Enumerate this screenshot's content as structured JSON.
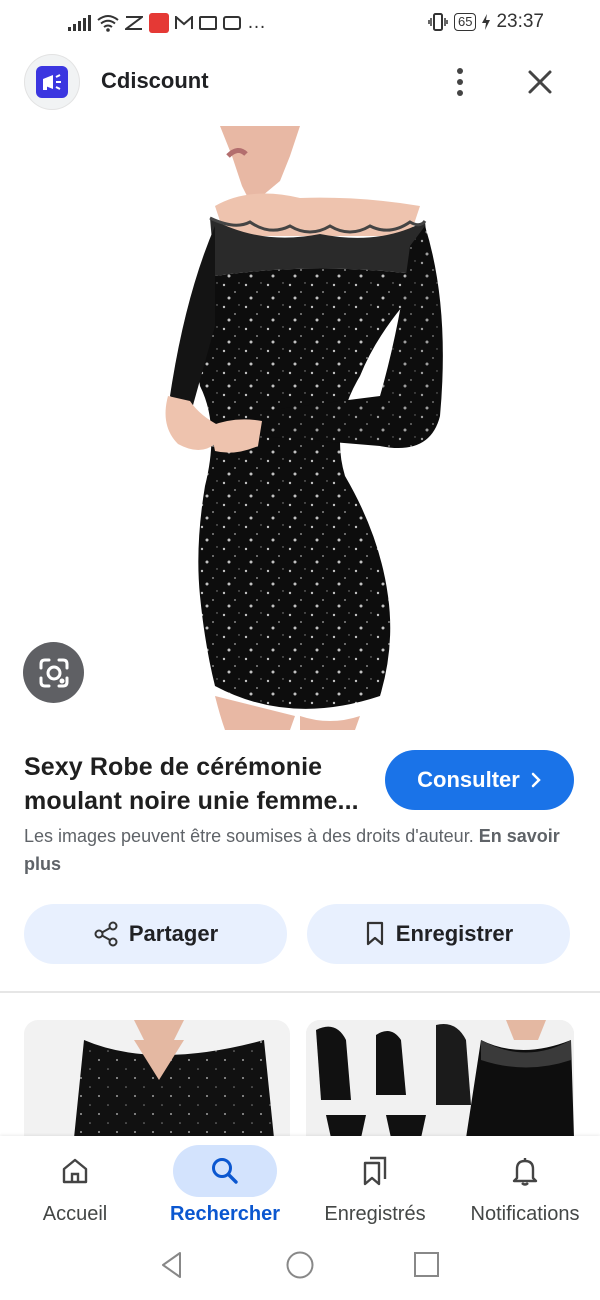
{
  "status_bar": {
    "time": "23:37",
    "battery": "65",
    "overflow": "…"
  },
  "app_bar": {
    "title": "Cdiscount",
    "logo_icon": "megaphone-icon",
    "menu_icon": "more-vertical-icon",
    "close_icon": "close-icon"
  },
  "product": {
    "title_line1": "Sexy Robe de cérémonie",
    "title_line2": "moulant noire unie femme...",
    "consult_label": "Consulter",
    "copyright_text": "Les images peuvent être soumises à des droits d'auteur.",
    "learn_more": "En savoir plus"
  },
  "actions": {
    "share_label": "Partager",
    "save_label": "Enregistrer"
  },
  "bottom_nav": {
    "items": [
      {
        "label": "Accueil",
        "icon": "home-icon"
      },
      {
        "label": "Rechercher",
        "icon": "search-icon",
        "active": true
      },
      {
        "label": "Enregistrés",
        "icon": "bookmarks-icon"
      },
      {
        "label": "Notifications",
        "icon": "bell-icon"
      }
    ]
  },
  "colors": {
    "accent": "#1a73e8",
    "pill_bg": "#e8f0fe",
    "active_nav_bg": "#d3e3fd",
    "logo_bg": "#3b36e0"
  }
}
